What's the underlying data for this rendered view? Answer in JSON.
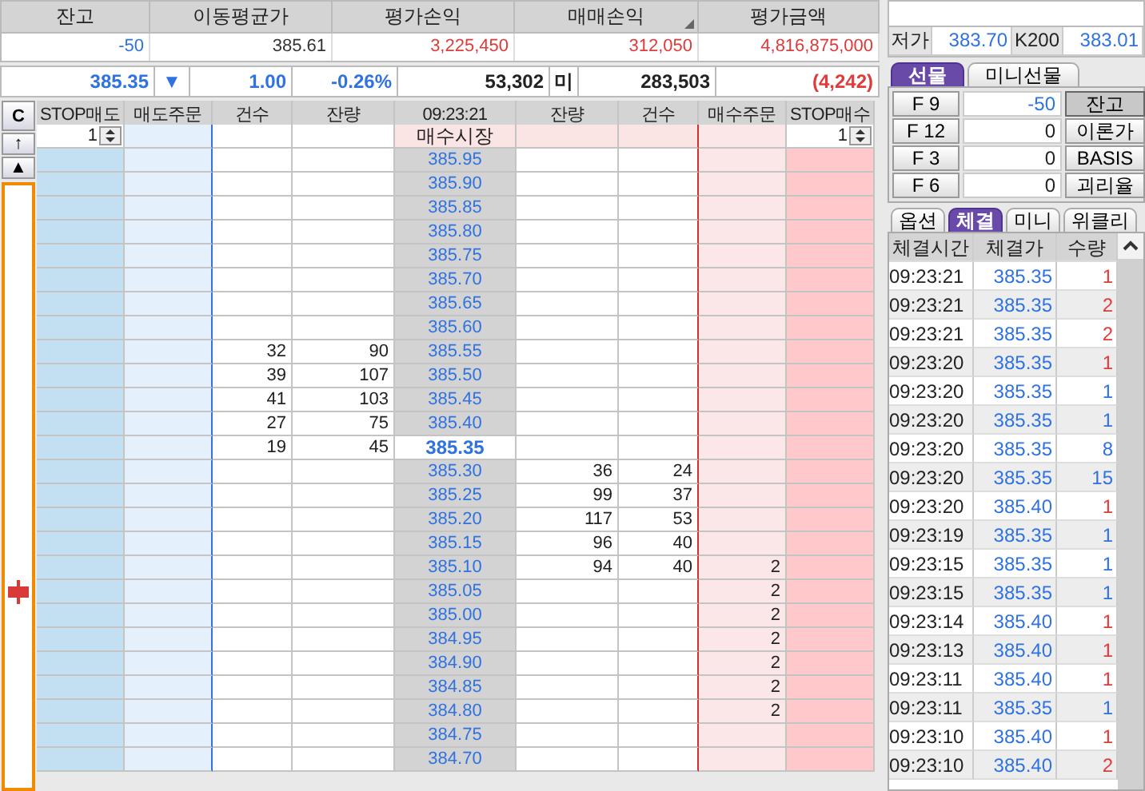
{
  "summary": [
    {
      "label": "잔고",
      "value": "-50",
      "color": "#2f72e0",
      "sorted": false
    },
    {
      "label": "이동평균가",
      "value": "385.61",
      "color": "#333333",
      "sorted": false
    },
    {
      "label": "평가손익",
      "value": "3,225,450",
      "color": "#e03a3a",
      "sorted": false
    },
    {
      "label": "매매손익",
      "value": "312,050",
      "color": "#e03a3a",
      "sorted": true
    },
    {
      "label": "평가금액",
      "value": "4,816,875,000",
      "color": "#e03a3a",
      "sorted": false
    }
  ],
  "quote": {
    "price": "385.35",
    "direction": "▼",
    "change": "1.00",
    "rate": "-0.26%",
    "volume": "53,302",
    "oi_label": "미",
    "open_interest": "283,503",
    "oi_change": "(4,242)"
  },
  "order_book": {
    "side_buttons": [
      "C",
      "↑",
      "▲"
    ],
    "columns": [
      "STOP매도",
      "매도주문",
      "건수",
      "잔량",
      "09:23:21",
      "잔량",
      "건수",
      "매수주문",
      "STOP매수"
    ],
    "market_row": {
      "stop_sell": "1",
      "label": "매수시장",
      "stop_buy": "1"
    },
    "rows": [
      {
        "price": "385.95",
        "current": false,
        "marker": false
      },
      {
        "price": "385.90",
        "current": false,
        "marker": false
      },
      {
        "price": "385.85",
        "current": false,
        "marker": false
      },
      {
        "price": "385.80",
        "current": false,
        "marker": false
      },
      {
        "price": "385.75",
        "current": false,
        "marker": false
      },
      {
        "price": "385.70",
        "current": false,
        "marker": false
      },
      {
        "price": "385.65",
        "current": false,
        "marker": false
      },
      {
        "price": "385.60",
        "current": false,
        "marker": false
      },
      {
        "price": "385.55",
        "current": false,
        "marker": false,
        "ask_count": "32",
        "ask_qty": "90"
      },
      {
        "price": "385.50",
        "current": false,
        "marker": false,
        "ask_count": "39",
        "ask_qty": "107"
      },
      {
        "price": "385.45",
        "current": false,
        "marker": false,
        "ask_count": "41",
        "ask_qty": "103"
      },
      {
        "price": "385.40",
        "current": false,
        "marker": false,
        "ask_count": "27",
        "ask_qty": "75"
      },
      {
        "price": "385.35",
        "current": true,
        "marker": false,
        "ask_count": "19",
        "ask_qty": "45"
      },
      {
        "price": "385.30",
        "current": false,
        "marker": false,
        "bid_qty": "36",
        "bid_count": "24"
      },
      {
        "price": "385.25",
        "current": false,
        "marker": false,
        "bid_qty": "99",
        "bid_count": "37"
      },
      {
        "price": "385.20",
        "current": false,
        "marker": false,
        "bid_qty": "117",
        "bid_count": "53"
      },
      {
        "price": "385.15",
        "current": false,
        "marker": false,
        "bid_qty": "96",
        "bid_count": "40"
      },
      {
        "price": "385.10",
        "current": false,
        "marker": false,
        "bid_qty": "94",
        "bid_count": "40",
        "bid_order": "2"
      },
      {
        "price": "385.05",
        "current": false,
        "marker": true,
        "bid_order": "2"
      },
      {
        "price": "385.00",
        "current": false,
        "marker": false,
        "bid_order": "2"
      },
      {
        "price": "384.95",
        "current": false,
        "marker": false,
        "bid_order": "2"
      },
      {
        "price": "384.90",
        "current": false,
        "marker": false,
        "bid_order": "2"
      },
      {
        "price": "384.85",
        "current": false,
        "marker": false,
        "bid_order": "2"
      },
      {
        "price": "384.80",
        "current": false,
        "marker": false,
        "bid_order": "2"
      },
      {
        "price": "384.75",
        "current": false,
        "marker": false
      },
      {
        "price": "384.70",
        "current": false,
        "marker": false
      }
    ]
  },
  "price_panel": {
    "rows": [
      {
        "label": "저가",
        "value": "383.70",
        "label2": "K200",
        "value2": "383.01"
      }
    ]
  },
  "futures_tabs": [
    {
      "label": "선물",
      "selected": true
    },
    {
      "label": "미니선물",
      "selected": false
    }
  ],
  "futures": [
    {
      "code": "F 9",
      "value": "-50",
      "color": "#2f72e0",
      "button": "잔고",
      "selected": true
    },
    {
      "code": "F 12",
      "value": "0",
      "color": "#222222",
      "button": "이론가",
      "selected": false
    },
    {
      "code": "F 3",
      "value": "0",
      "color": "#222222",
      "button": "BASIS",
      "selected": false
    },
    {
      "code": "F 6",
      "value": "0",
      "color": "#222222",
      "button": "괴리율",
      "selected": false
    }
  ],
  "trade_tabs": [
    {
      "label": "옵션",
      "selected": false
    },
    {
      "label": "체결",
      "selected": true
    },
    {
      "label": "미니",
      "selected": false
    },
    {
      "label": "위클리",
      "selected": false
    }
  ],
  "trades": {
    "columns": [
      "체결시간",
      "체결가",
      "수량"
    ],
    "rows": [
      {
        "time": "09:23:21",
        "price": "385.35",
        "qty": "1",
        "color": "#e03a3a"
      },
      {
        "time": "09:23:21",
        "price": "385.35",
        "qty": "2",
        "color": "#e03a3a"
      },
      {
        "time": "09:23:21",
        "price": "385.35",
        "qty": "2",
        "color": "#e03a3a"
      },
      {
        "time": "09:23:20",
        "price": "385.35",
        "qty": "1",
        "color": "#e03a3a"
      },
      {
        "time": "09:23:20",
        "price": "385.35",
        "qty": "1",
        "color": "#2f72e0"
      },
      {
        "time": "09:23:20",
        "price": "385.35",
        "qty": "1",
        "color": "#2f72e0"
      },
      {
        "time": "09:23:20",
        "price": "385.35",
        "qty": "8",
        "color": "#2f72e0"
      },
      {
        "time": "09:23:20",
        "price": "385.35",
        "qty": "15",
        "color": "#2f72e0"
      },
      {
        "time": "09:23:20",
        "price": "385.40",
        "qty": "1",
        "color": "#e03a3a"
      },
      {
        "time": "09:23:19",
        "price": "385.35",
        "qty": "1",
        "color": "#2f72e0"
      },
      {
        "time": "09:23:15",
        "price": "385.35",
        "qty": "1",
        "color": "#2f72e0"
      },
      {
        "time": "09:23:15",
        "price": "385.35",
        "qty": "1",
        "color": "#2f72e0"
      },
      {
        "time": "09:23:14",
        "price": "385.40",
        "qty": "1",
        "color": "#e03a3a"
      },
      {
        "time": "09:23:13",
        "price": "385.40",
        "qty": "1",
        "color": "#e03a3a"
      },
      {
        "time": "09:23:11",
        "price": "385.40",
        "qty": "1",
        "color": "#e03a3a"
      },
      {
        "time": "09:23:11",
        "price": "385.35",
        "qty": "1",
        "color": "#2f72e0"
      },
      {
        "time": "09:23:10",
        "price": "385.40",
        "qty": "1",
        "color": "#e03a3a"
      },
      {
        "time": "09:23:10",
        "price": "385.40",
        "qty": "2",
        "color": "#e03a3a"
      }
    ]
  }
}
